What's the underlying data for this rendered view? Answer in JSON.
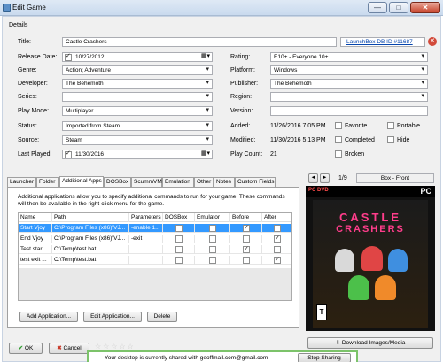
{
  "window": {
    "title": "Edit Game",
    "minimize_glyph": "—",
    "maximize_glyph": "□",
    "close_glyph": "✕"
  },
  "details": {
    "section_label": "Details",
    "title_label": "Title:",
    "title_value": "Castle Crashers",
    "launchbox_link": "LaunchBox DB ID #11687",
    "release_date_label": "Release Date:",
    "release_date_value": "10/27/2012",
    "rating_label": "Rating:",
    "rating_value": "E10+ - Everyone 10+",
    "genre_label": "Genre:",
    "genre_value": "Action; Adventure",
    "platform_label": "Platform:",
    "platform_value": "Windows",
    "developer_label": "Developer:",
    "developer_value": "The Behemoth",
    "publisher_label": "Publisher:",
    "publisher_value": "The Behemoth",
    "series_label": "Series:",
    "series_value": "",
    "region_label": "Region:",
    "region_value": "",
    "playmode_label": "Play Mode:",
    "playmode_value": "Multiplayer",
    "version_label": "Version:",
    "version_value": "",
    "status_label": "Status:",
    "status_value": "Imported from Steam",
    "added_label": "Added:",
    "added_value": "11/26/2016 7:05 PM",
    "source_label": "Source:",
    "source_value": "Steam",
    "modified_label": "Modified:",
    "modified_value": "11/30/2016 5:13 PM",
    "lastplayed_label": "Last Played:",
    "lastplayed_value": "11/30/2016",
    "playcount_label": "Play Count:",
    "playcount_value": "21",
    "favorite_label": "Favorite",
    "portable_label": "Portable",
    "completed_label": "Completed",
    "hide_label": "Hide",
    "broken_label": "Broken"
  },
  "tabs": [
    {
      "label": "Launcher"
    },
    {
      "label": "Folder"
    },
    {
      "label": "Additional Apps"
    },
    {
      "label": "DOSBox"
    },
    {
      "label": "ScummVM"
    },
    {
      "label": "Emulation"
    },
    {
      "label": "Other"
    },
    {
      "label": "Notes"
    },
    {
      "label": "Custom Fields"
    }
  ],
  "additional_apps": {
    "description": "Additional applications allow you to specify additional commands to run for your game.  These commands will then be available in the right-click menu for the game.",
    "columns": [
      "Name",
      "Path",
      "Parameters",
      "DOSBox",
      "Emulator",
      "Before",
      "After"
    ],
    "rows": [
      {
        "name": "Start Vjoy",
        "path": "C:\\Program Files (x86)\\VJ...",
        "params": "-enable 1...",
        "dosbox": false,
        "emulator": false,
        "before": true,
        "after": false,
        "selected": true
      },
      {
        "name": "End Vjoy",
        "path": "C:\\Program Files (x86)\\VJ...",
        "params": "-exit",
        "dosbox": false,
        "emulator": false,
        "before": false,
        "after": true,
        "selected": false
      },
      {
        "name": "Test star...",
        "path": "C:\\Temp\\test.bat",
        "params": "",
        "dosbox": false,
        "emulator": false,
        "before": true,
        "after": false,
        "selected": false
      },
      {
        "name": "test exit ...",
        "path": "C:\\Temp\\test.bat",
        "params": "",
        "dosbox": false,
        "emulator": false,
        "before": false,
        "after": true,
        "selected": false
      }
    ],
    "add_button": "Add Application...",
    "edit_button": "Edit Application...",
    "delete_button": "Delete"
  },
  "media": {
    "prev_glyph": "◄",
    "next_glyph": "►",
    "counter": "1/9",
    "image_type": "Box - Front",
    "cover_top_left": "PC DVD",
    "cover_top_right": "PC",
    "cover_title_top": "CASTLE",
    "cover_title_bottom": "CRASHERS",
    "download_button": "Download Images/Media"
  },
  "footer": {
    "ok_label": "OK",
    "cancel_label": "Cancel",
    "stars": [
      "☆",
      "☆",
      "☆",
      "☆",
      "☆"
    ],
    "share_text": "Your desktop is currently shared with geoffmail.com@gmail.com",
    "stop_sharing": "Stop Sharing"
  },
  "colors": {
    "selected_row": "#3399ff",
    "link": "#0645ad",
    "share_border": "#7cc36a",
    "cover_accent": "#ff3d8b"
  }
}
